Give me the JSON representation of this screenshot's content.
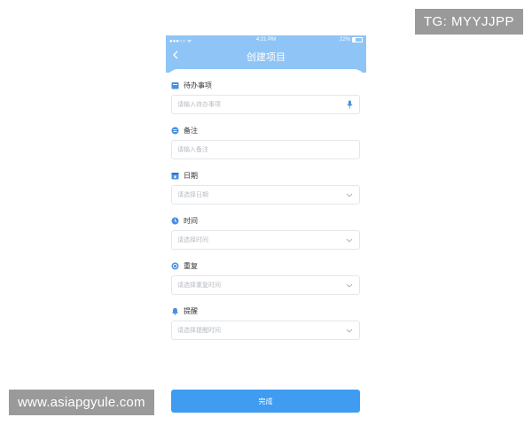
{
  "watermarks": {
    "tg": "TG: MYYJJPP",
    "site": "www.asiapgyule.com"
  },
  "status_bar": {
    "signal": "●●●○○ ᯤ",
    "time": "4:21 PM",
    "battery": "22%"
  },
  "nav": {
    "title": "创建项目"
  },
  "form": {
    "todo": {
      "label": "待办事项",
      "placeholder": "请输入待办事项"
    },
    "note": {
      "label": "备注",
      "placeholder": "请输入备注"
    },
    "date": {
      "label": "日期",
      "placeholder": "请选择日期"
    },
    "time": {
      "label": "时间",
      "placeholder": "请选择时间"
    },
    "repeat": {
      "label": "重复",
      "placeholder": "请选择重复时间"
    },
    "reminder": {
      "label": "提醒",
      "placeholder": "请选择提醒时间"
    }
  },
  "submit_label": "完成",
  "colors": {
    "header": "#8fc4f6",
    "accent": "#3f9cf1",
    "icon": "#4a90e2"
  }
}
